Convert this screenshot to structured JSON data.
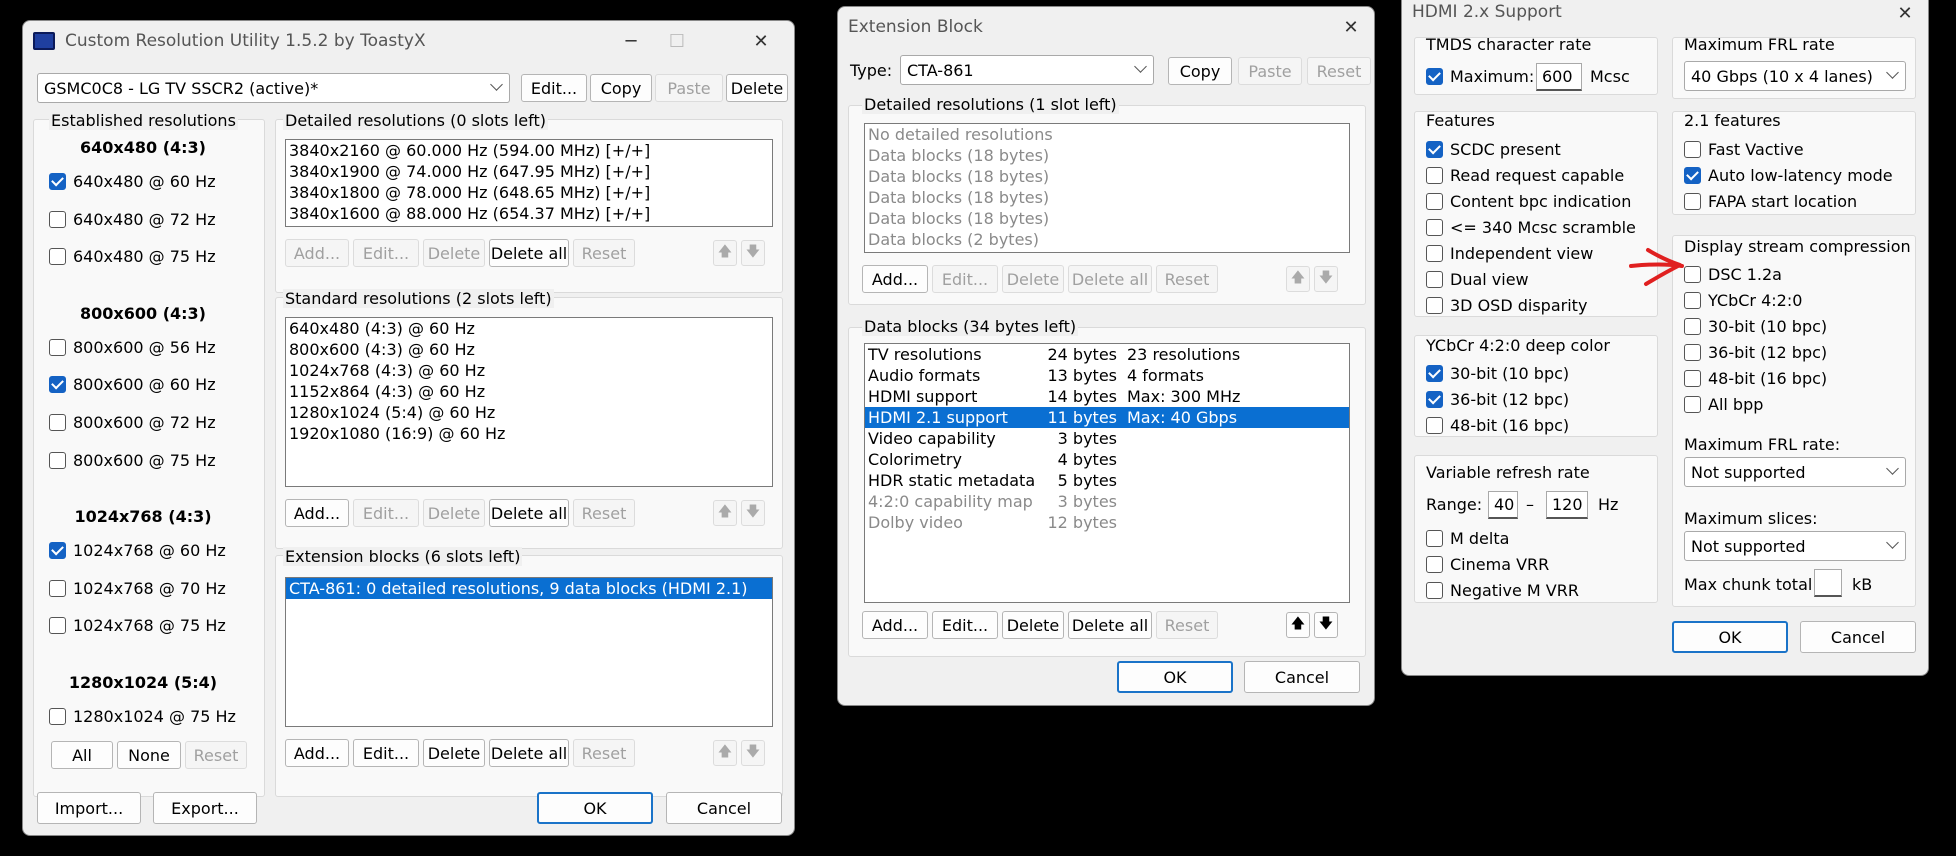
{
  "cru": {
    "title": "Custom Resolution Utility 1.5.2 by ToastyX",
    "display_select": "GSMC0C8 - LG TV SSCR2 (active)*",
    "top_buttons": {
      "edit": "Edit...",
      "copy": "Copy",
      "paste": "Paste",
      "delete": "Delete"
    },
    "established": {
      "title": "Established resolutions",
      "groups": [
        {
          "heading": "640x480 (4:3)",
          "items": [
            {
              "label": "640x480 @ 60 Hz",
              "checked": true
            },
            {
              "label": "640x480 @ 72 Hz",
              "checked": false
            },
            {
              "label": "640x480 @ 75 Hz",
              "checked": false
            }
          ]
        },
        {
          "heading": "800x600 (4:3)",
          "items": [
            {
              "label": "800x600 @ 56 Hz",
              "checked": false
            },
            {
              "label": "800x600 @ 60 Hz",
              "checked": true
            },
            {
              "label": "800x600 @ 72 Hz",
              "checked": false
            },
            {
              "label": "800x600 @ 75 Hz",
              "checked": false
            }
          ]
        },
        {
          "heading": "1024x768 (4:3)",
          "items": [
            {
              "label": "1024x768 @ 60 Hz",
              "checked": true
            },
            {
              "label": "1024x768 @ 70 Hz",
              "checked": false
            },
            {
              "label": "1024x768 @ 75 Hz",
              "checked": false
            }
          ]
        },
        {
          "heading": "1280x1024 (5:4)",
          "items": [
            {
              "label": "1280x1024 @ 75 Hz",
              "checked": false
            }
          ]
        }
      ],
      "buttons": {
        "all": "All",
        "none": "None",
        "reset": "Reset"
      }
    },
    "detailed": {
      "title": "Detailed resolutions (0 slots left)",
      "items": [
        "3840x2160 @ 60.000 Hz (594.00 MHz) [+/+]",
        "3840x1900 @ 74.000 Hz (647.95 MHz) [+/+]",
        "3840x1800 @ 78.000 Hz (648.65 MHz) [+/+]",
        "3840x1600 @ 88.000 Hz (654.37 MHz) [+/+]"
      ]
    },
    "standard": {
      "title": "Standard resolutions (2 slots left)",
      "items": [
        "640x480 (4:3) @ 60 Hz",
        "800x600 (4:3) @ 60 Hz",
        "1024x768 (4:3) @ 60 Hz",
        "1152x864 (4:3) @ 60 Hz",
        "1280x1024 (5:4) @ 60 Hz",
        "1920x1080 (16:9) @ 60 Hz"
      ]
    },
    "extension": {
      "title": "Extension blocks (6 slots left)",
      "items": [
        "CTA-861: 0 detailed resolutions, 9 data blocks (HDMI 2.1)"
      ]
    },
    "list_buttons": {
      "add": "Add...",
      "edit": "Edit...",
      "delete": "Delete",
      "delete_all": "Delete all",
      "reset": "Reset"
    },
    "bottom": {
      "import": "Import...",
      "export": "Export...",
      "ok": "OK",
      "cancel": "Cancel"
    }
  },
  "ext": {
    "title": "Extension Block",
    "type_label": "Type:",
    "type_value": "CTA-861",
    "top_buttons": {
      "copy": "Copy",
      "paste": "Paste",
      "reset": "Reset"
    },
    "detailed": {
      "title": "Detailed resolutions (1 slot left)",
      "items": [
        "No detailed resolutions",
        "Data blocks (18 bytes)",
        "Data blocks (18 bytes)",
        "Data blocks (18 bytes)",
        "Data blocks (18 bytes)",
        "Data blocks (2 bytes)"
      ]
    },
    "data_blocks": {
      "title": "Data blocks (34 bytes left)",
      "rows": [
        {
          "name": "TV resolutions",
          "size": "24 bytes",
          "info": "23 resolutions",
          "dim": false,
          "sel": false
        },
        {
          "name": "Audio formats",
          "size": "13 bytes",
          "info": "4 formats",
          "dim": false,
          "sel": false
        },
        {
          "name": "HDMI support",
          "size": "14 bytes",
          "info": "Max: 300 MHz",
          "dim": false,
          "sel": false
        },
        {
          "name": "HDMI 2.1 support",
          "size": "11 bytes",
          "info": "Max: 40 Gbps",
          "dim": false,
          "sel": true
        },
        {
          "name": "Video capability",
          "size": "3 bytes",
          "info": "",
          "dim": false,
          "sel": false
        },
        {
          "name": "Colorimetry",
          "size": "4 bytes",
          "info": "",
          "dim": false,
          "sel": false
        },
        {
          "name": "HDR static metadata",
          "size": "5 bytes",
          "info": "",
          "dim": false,
          "sel": false
        },
        {
          "name": "4:2:0 capability map",
          "size": "3 bytes",
          "info": "",
          "dim": true,
          "sel": false
        },
        {
          "name": "Dolby video",
          "size": "12 bytes",
          "info": "",
          "dim": true,
          "sel": false
        }
      ]
    },
    "list_buttons": {
      "add": "Add...",
      "edit": "Edit...",
      "delete": "Delete",
      "delete_all": "Delete all",
      "reset": "Reset"
    },
    "bottom": {
      "ok": "OK",
      "cancel": "Cancel"
    }
  },
  "hdmi": {
    "title": "HDMI 2.x Support",
    "tmds": {
      "title": "TMDS character rate",
      "max_label": "Maximum:",
      "max_value": "600",
      "unit": "Mcsc",
      "checked": true
    },
    "features": {
      "title": "Features",
      "items": [
        {
          "label": "SCDC present",
          "checked": true
        },
        {
          "label": "Read request capable",
          "checked": false
        },
        {
          "label": "Content bpc indication",
          "checked": false
        },
        {
          "label": "<= 340 Mcsc scramble",
          "checked": false
        },
        {
          "label": "Independent view",
          "checked": false
        },
        {
          "label": "Dual view",
          "checked": false
        },
        {
          "label": "3D OSD disparity",
          "checked": false
        }
      ]
    },
    "ycbcr": {
      "title": "YCbCr 4:2:0 deep color",
      "items": [
        {
          "label": "30-bit (10 bpc)",
          "checked": true
        },
        {
          "label": "36-bit (12 bpc)",
          "checked": true
        },
        {
          "label": "48-bit (16 bpc)",
          "checked": false
        }
      ]
    },
    "vrr": {
      "title": "Variable refresh rate",
      "range_label": "Range:",
      "min": "40",
      "dash": "–",
      "max": "120",
      "unit": "Hz",
      "items": [
        {
          "label": "M delta",
          "checked": false
        },
        {
          "label": "Cinema VRR",
          "checked": false
        },
        {
          "label": "Negative M VRR",
          "checked": false
        }
      ]
    },
    "frl": {
      "title": "Maximum FRL rate",
      "value": "40 Gbps (10 x 4 lanes)"
    },
    "f21": {
      "title": "2.1 features",
      "items": [
        {
          "label": "Fast Vactive",
          "checked": false
        },
        {
          "label": "Auto low-latency mode",
          "checked": true
        },
        {
          "label": "FAPA start location",
          "checked": false
        }
      ]
    },
    "dsc": {
      "title": "Display stream compression",
      "items": [
        {
          "label": "DSC 1.2a",
          "checked": false
        },
        {
          "label": "YCbCr 4:2:0",
          "checked": false
        },
        {
          "label": "30-bit (10 bpc)",
          "checked": false
        },
        {
          "label": "36-bit (12 bpc)",
          "checked": false
        },
        {
          "label": "48-bit (16 bpc)",
          "checked": false
        },
        {
          "label": "All bpp",
          "checked": false
        }
      ],
      "frl_label": "Maximum FRL rate:",
      "frl_value": "Not supported",
      "slices_label": "Maximum slices:",
      "slices_value": "Not supported",
      "chunk_label": "Max chunk total:",
      "chunk_value": "",
      "chunk_unit": "kB"
    },
    "bottom": {
      "ok": "OK",
      "cancel": "Cancel"
    }
  },
  "colors": {
    "accent": "#1462c4",
    "selection": "#0a6fd2",
    "annotation": "#e02020"
  }
}
